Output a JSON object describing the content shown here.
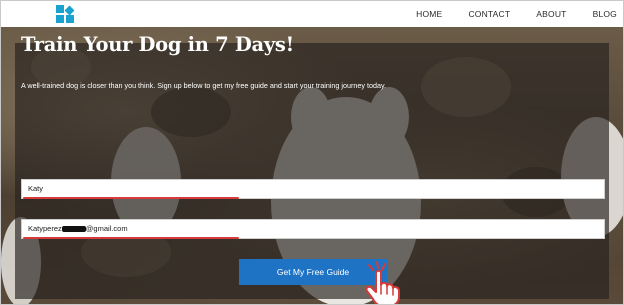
{
  "nav": {
    "logo_icon": "logo-blocks-icon",
    "links": [
      "HOME",
      "CONTACT",
      "ABOUT",
      "BLOG"
    ]
  },
  "hero": {
    "title": "Train Your Dog in 7 Days!",
    "subtitle": "A well-trained dog is closer than you think. Sign up below to get my free guide and start your training journey today."
  },
  "form": {
    "name_value": "Katy",
    "email_prefix": "Katyperez",
    "email_suffix": "@gmail.com",
    "submit_label": "Get My Free Guide"
  },
  "colors": {
    "accent": "#1ba3cf",
    "button": "#1f73c4",
    "annotation": "#d63a3a"
  },
  "annotation_icon": "pointing-hand-cursor-icon"
}
